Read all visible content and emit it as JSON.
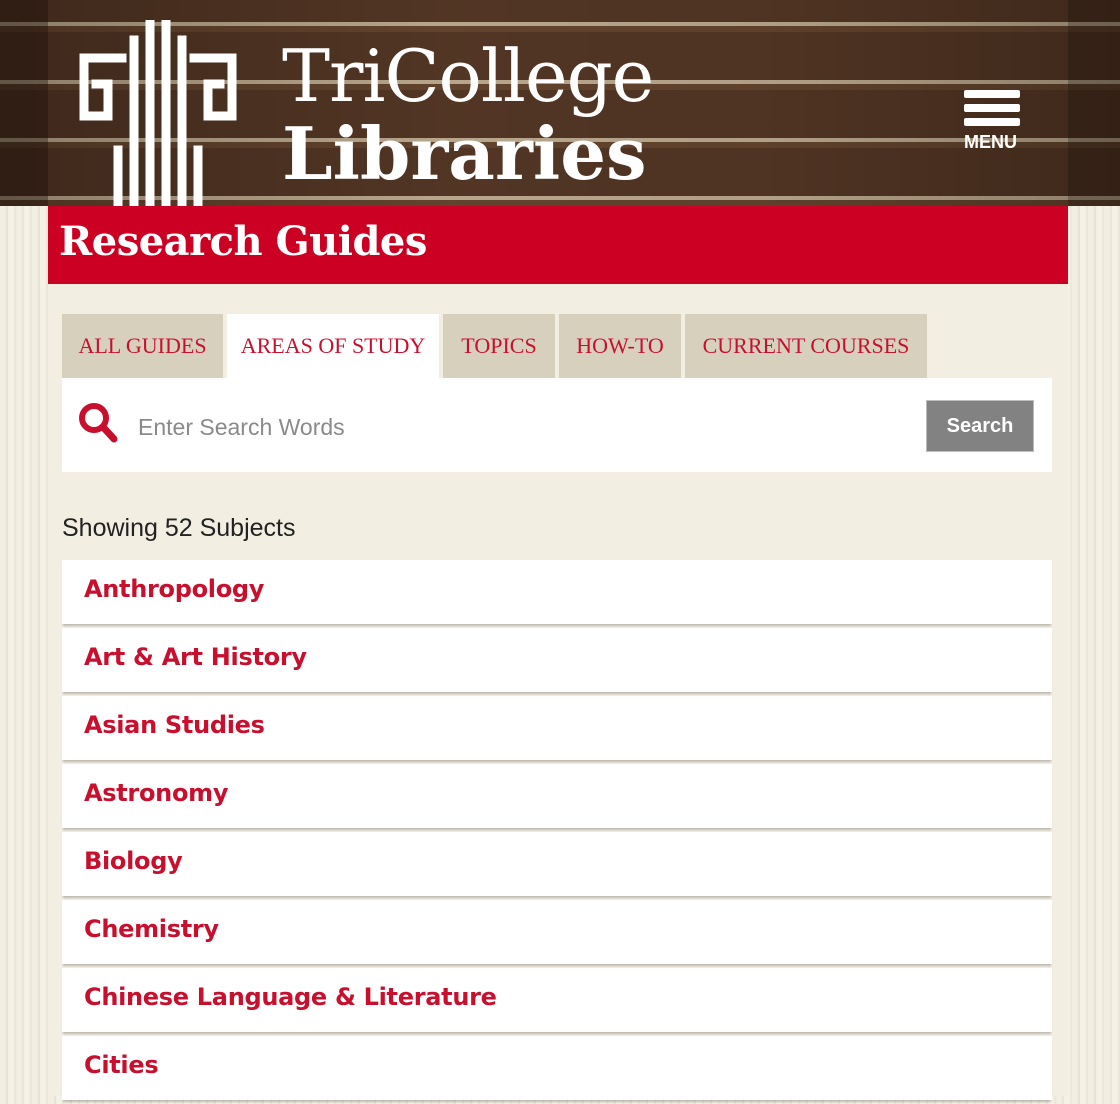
{
  "header": {
    "logo_line1": "TriCollege",
    "logo_line2": "Libraries",
    "menu_label": "MENU"
  },
  "page_title": "Research Guides",
  "tabs": [
    {
      "label": "ALL GUIDES",
      "active": false
    },
    {
      "label": "AREAS OF STUDY",
      "active": true
    },
    {
      "label": "TOPICS",
      "active": false
    },
    {
      "label": "HOW-TO",
      "active": false
    },
    {
      "label": "CURRENT COURSES",
      "active": false
    }
  ],
  "search": {
    "placeholder": "Enter Search Words",
    "value": "",
    "button_label": "Search"
  },
  "results_count": "Showing 52 Subjects",
  "subjects": [
    "Anthropology",
    "Art & Art History",
    "Asian Studies",
    "Astronomy",
    "Biology",
    "Chemistry",
    "Chinese Language & Literature",
    "Cities"
  ],
  "colors": {
    "accent_red": "#cc0022",
    "link_red": "#c8102e",
    "tab_bg": "#d6d0bd",
    "page_bg": "#f3eee2",
    "search_button": "#828282"
  }
}
